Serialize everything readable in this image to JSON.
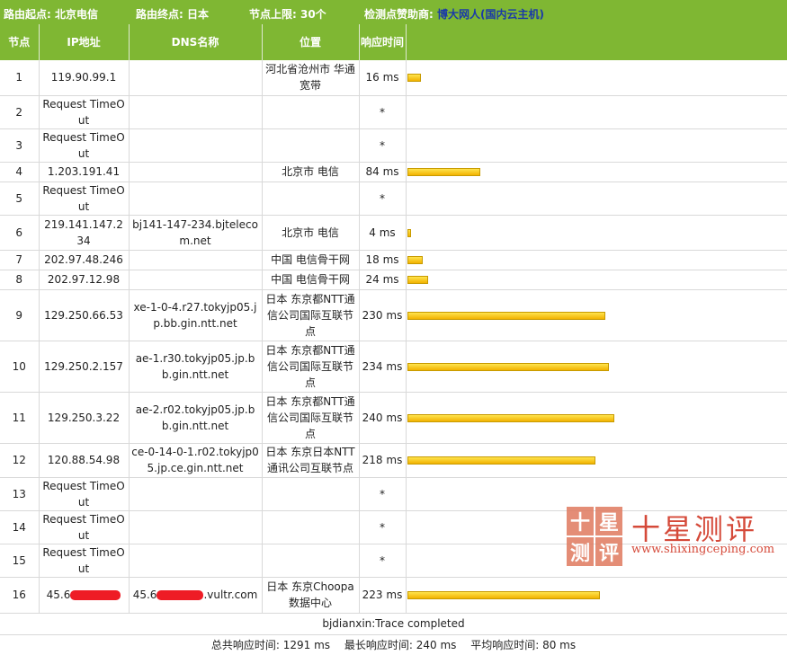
{
  "header": {
    "start_label": "路由起点: 北京电信",
    "end_label": "路由终点: 日本",
    "limit_label": "节点上限: 30个",
    "sponsor_label": "检测点赞助商:",
    "sponsor_name": "博大网人",
    "sponsor_sub": "(国内云主机)"
  },
  "columns": [
    "节点",
    "IP地址",
    "DNS名称",
    "位置",
    "响应时间"
  ],
  "hops": [
    {
      "hop": "1",
      "ip": "119.90.99.1",
      "dns": "",
      "loc": "河北省沧州市 华通宽带",
      "time": "16 ms",
      "ms": 16
    },
    {
      "hop": "2",
      "ip": "Request TimeOut",
      "dns": "",
      "loc": "",
      "time": "*",
      "ms": 0
    },
    {
      "hop": "3",
      "ip": "Request TimeOut",
      "dns": "",
      "loc": "",
      "time": "*",
      "ms": 0
    },
    {
      "hop": "4",
      "ip": "1.203.191.41",
      "dns": "",
      "loc": "北京市 电信",
      "time": "84 ms",
      "ms": 84
    },
    {
      "hop": "5",
      "ip": "Request TimeOut",
      "dns": "",
      "loc": "",
      "time": "*",
      "ms": 0
    },
    {
      "hop": "6",
      "ip": "219.141.147.234",
      "dns": "bj141-147-234.bjtelecom.net",
      "loc": "北京市 电信",
      "time": "4 ms",
      "ms": 4
    },
    {
      "hop": "7",
      "ip": "202.97.48.246",
      "dns": "",
      "loc": "中国 电信骨干网",
      "time": "18 ms",
      "ms": 18
    },
    {
      "hop": "8",
      "ip": "202.97.12.98",
      "dns": "",
      "loc": "中国 电信骨干网",
      "time": "24 ms",
      "ms": 24
    },
    {
      "hop": "9",
      "ip": "129.250.66.53",
      "dns": "xe-1-0-4.r27.tokyjp05.jp.bb.gin.ntt.net",
      "loc": "日本 东京都NTT通信公司国际互联节点",
      "time": "230 ms",
      "ms": 230
    },
    {
      "hop": "10",
      "ip": "129.250.2.157",
      "dns": "ae-1.r30.tokyjp05.jp.bb.gin.ntt.net",
      "loc": "日本 东京都NTT通信公司国际互联节点",
      "time": "234 ms",
      "ms": 234
    },
    {
      "hop": "11",
      "ip": "129.250.3.22",
      "dns": "ae-2.r02.tokyjp05.jp.bb.gin.ntt.net",
      "loc": "日本 东京都NTT通信公司国际互联节点",
      "time": "240 ms",
      "ms": 240
    },
    {
      "hop": "12",
      "ip": "120.88.54.98",
      "dns": "ce-0-14-0-1.r02.tokyjp05.jp.ce.gin.ntt.net",
      "loc": "日本 东京日本NTT通讯公司互联节点",
      "time": "218 ms",
      "ms": 218
    },
    {
      "hop": "13",
      "ip": "Request TimeOut",
      "dns": "",
      "loc": "",
      "time": "*",
      "ms": 0
    },
    {
      "hop": "14",
      "ip": "Request TimeOut",
      "dns": "",
      "loc": "",
      "time": "*",
      "ms": 0
    },
    {
      "hop": "15",
      "ip": "Request TimeOut",
      "dns": "",
      "loc": "",
      "time": "*",
      "ms": 0
    },
    {
      "hop": "16",
      "ip": "45.6",
      "dns": "45.6",
      "dns_suffix": ".vultr.com",
      "loc": "日本 东京Choopa数据中心",
      "time": "223 ms",
      "ms": 223,
      "redacted": true
    }
  ],
  "footer": {
    "completed": "bjdianxin:Trace completed",
    "summary": "总共响应时间: 1291 ms　 最长响应时间: 240 ms　 平均响应时间: 80 ms"
  },
  "watermark": {
    "seal_chars": [
      "十",
      "星",
      "测",
      "评"
    ],
    "title": "十星测评",
    "url": "www.shixingceping.com"
  },
  "colors": {
    "header_bg": "#7fb733",
    "bar": "#f2b200",
    "redaction": "#ee1c25",
    "watermark": "#d54a3a"
  }
}
